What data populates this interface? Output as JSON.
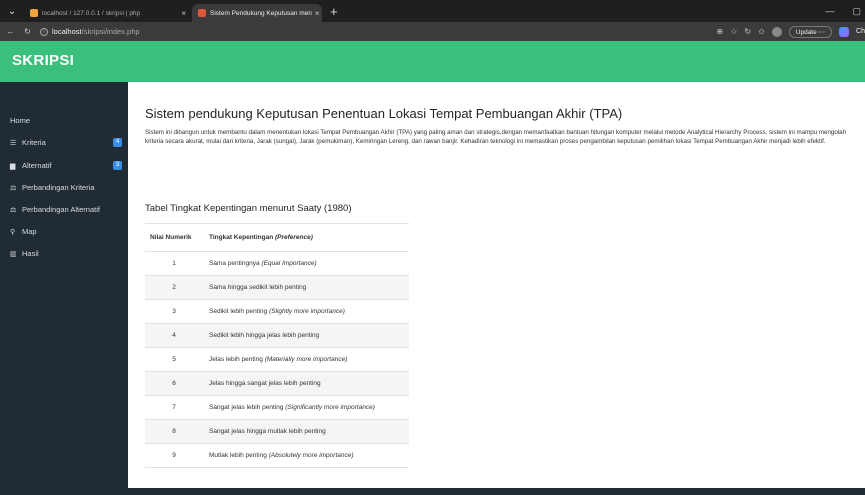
{
  "browser": {
    "tabs": [
      {
        "label": "localhost / 127.0.0.1 / skripsi | php",
        "close": "×"
      },
      {
        "label": "Sistem Pendukung Keputusan men",
        "close": "×"
      }
    ],
    "new_tab": "+",
    "url_host": "localhost",
    "url_path": "/skripsi/index.php",
    "update_label": "Update ⋯",
    "copilot_label": "Ch"
  },
  "app": {
    "brand": "SKRIPSI"
  },
  "sidebar": {
    "items": [
      {
        "label": "Home",
        "icon": "none"
      },
      {
        "label": "Kriteria",
        "icon": "list-icon",
        "badge": "4"
      },
      {
        "label": "Alternatif",
        "icon": "book-icon",
        "badge": "3"
      },
      {
        "label": "Perbandingan Kriteria",
        "icon": "balance-scale-icon"
      },
      {
        "label": "Perbandingan Alternatif",
        "icon": "balance-scale-icon"
      },
      {
        "label": "Map",
        "icon": "map-marker-icon"
      },
      {
        "label": "Hasil",
        "icon": "bar-chart-icon"
      }
    ]
  },
  "main": {
    "title": "Sistem pendukung Keputusan Penentuan Lokasi Tempat Pembuangan Akhir (TPA)",
    "description": "Sistem ini dibangun untuk membantu dalam menentukan lokasi Tempat Pembuangan Akhir (TPA) yang paling aman dan strategis,dengan memanfaatkan bantuan hitungan komputer melalui metode Analytical Hierarchy Process, sistem ini mampu mengolah kriteria secara akurat, mulai dari kriteria, Jarak (sungai), Jarak (pemukiman), Kemiringan Lereng, dan rawan banjir. Kehadiran teknologi ini memastikan proses pengambilan keputusan pemilihan lokasi Tempat Pembuangan Akhir menjadi lebih efektif.",
    "table_title": "Tabel Tingkat Kepentingan menurut Saaty (1980)",
    "table": {
      "headers": [
        "Nilai Numerik",
        "Tingkat Kepentingan ",
        "(Preference)"
      ],
      "rows": [
        {
          "num": "1",
          "text": "Sama pentingnya ",
          "italic": "(Equal Importance)"
        },
        {
          "num": "2",
          "text": "Sama hingga sedikit lebih penting",
          "italic": ""
        },
        {
          "num": "3",
          "text": "Sedikit lebih penting ",
          "italic": "(Slightly more importance)"
        },
        {
          "num": "4",
          "text": "Sedikit lebih hingga jelas lebih penting",
          "italic": ""
        },
        {
          "num": "5",
          "text": "Jelas lebih penting ",
          "italic": "(Materially more importance)"
        },
        {
          "num": "6",
          "text": "Jelas hingga sangat jelas lebih penting",
          "italic": ""
        },
        {
          "num": "7",
          "text": "Sangat jelas lebih penting ",
          "italic": "(Significantly more importance)"
        },
        {
          "num": "8",
          "text": "Sangat jelas hingga mutlak lebih penting",
          "italic": ""
        },
        {
          "num": "9",
          "text": "Mutlak lebih penting ",
          "italic": "(Absolutely more importance)"
        }
      ]
    }
  },
  "colors": {
    "header": "#3bbf7d",
    "sidebar": "#202b33",
    "badge": "#3a8ee6"
  }
}
